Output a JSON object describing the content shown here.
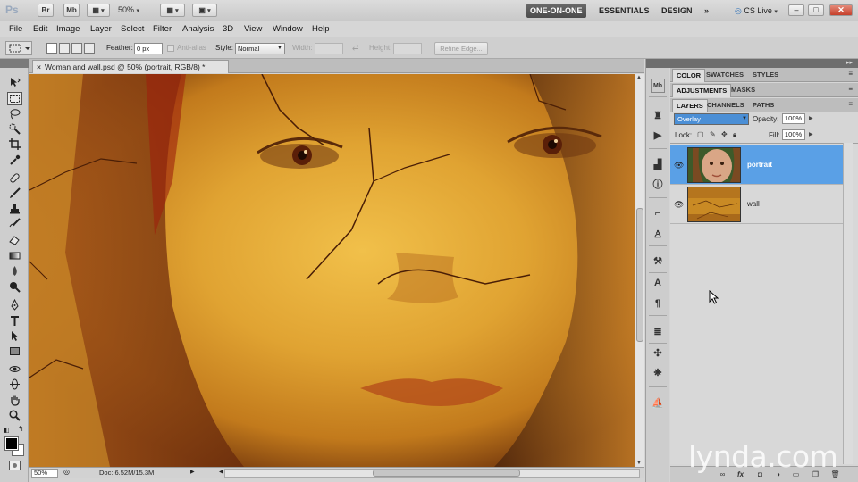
{
  "app": {
    "logo": "Ps",
    "bridge_label": "Br",
    "minibridge_label": "Mb",
    "zoom": "50%",
    "workspaces": [
      "ONE-ON-ONE",
      "ESSENTIALS",
      "DESIGN"
    ],
    "workspace_more": "»",
    "cs_live": "CS Live",
    "window_controls": [
      "–",
      "□",
      "✕"
    ]
  },
  "menu": [
    "File",
    "Edit",
    "Image",
    "Layer",
    "Select",
    "Filter",
    "Analysis",
    "3D",
    "View",
    "Window",
    "Help"
  ],
  "options": {
    "feather_label": "Feather:",
    "feather_value": "0 px",
    "antialias_label": "Anti-alias",
    "style_label": "Style:",
    "style_value": "Normal",
    "width_label": "Width:",
    "height_label": "Height:",
    "refine_label": "Refine Edge..."
  },
  "document": {
    "tab_title": "Woman and wall.psd @ 50% (portrait, RGB/8) *",
    "tab_close": "×",
    "status_zoom": "50%",
    "status_info": "Doc: 6.52M/15.3M"
  },
  "panels": {
    "group1_tabs": [
      "COLOR",
      "SWATCHES",
      "STYLES"
    ],
    "group2_tabs": [
      "ADJUSTMENTS",
      "MASKS"
    ],
    "group3_tabs": [
      "LAYERS",
      "CHANNELS",
      "PATHS"
    ]
  },
  "layers": {
    "blend_mode": "Overlay",
    "opacity_label": "Opacity:",
    "opacity_value": "100%",
    "lock_label": "Lock:",
    "fill_label": "Fill:",
    "fill_value": "100%",
    "items": [
      {
        "name": "portrait",
        "selected": true,
        "visible": true
      },
      {
        "name": "wall",
        "selected": false,
        "visible": true
      }
    ]
  },
  "watermark": "lynda.com",
  "colors": {
    "selection_blue": "#5aa0e6",
    "blend_blue": "#4b8fd6",
    "canvas_orange": "#d9951f"
  },
  "icons": {
    "tools": [
      "move-icon",
      "marquee-icon",
      "lasso-icon",
      "quick-select-icon",
      "crop-icon",
      "eyedropper-icon",
      "healing-icon",
      "brush-icon",
      "clone-stamp-icon",
      "history-brush-icon",
      "eraser-icon",
      "gradient-icon",
      "blur-icon",
      "dodge-icon",
      "pen-icon",
      "type-icon",
      "path-select-icon",
      "shape-icon",
      "3d-rotate-icon",
      "3d-orbit-icon",
      "hand-icon",
      "zoom-icon"
    ],
    "dock": [
      "minibridge-icon",
      "history-icon",
      "actions-icon",
      "histogram-icon",
      "info-icon",
      "brushes-icon",
      "clone-source-icon",
      "tool-presets-icon",
      "character-icon",
      "paragraph-icon",
      "notes-icon",
      "3d-icon",
      "animation-icon",
      "navigator-icon"
    ]
  }
}
